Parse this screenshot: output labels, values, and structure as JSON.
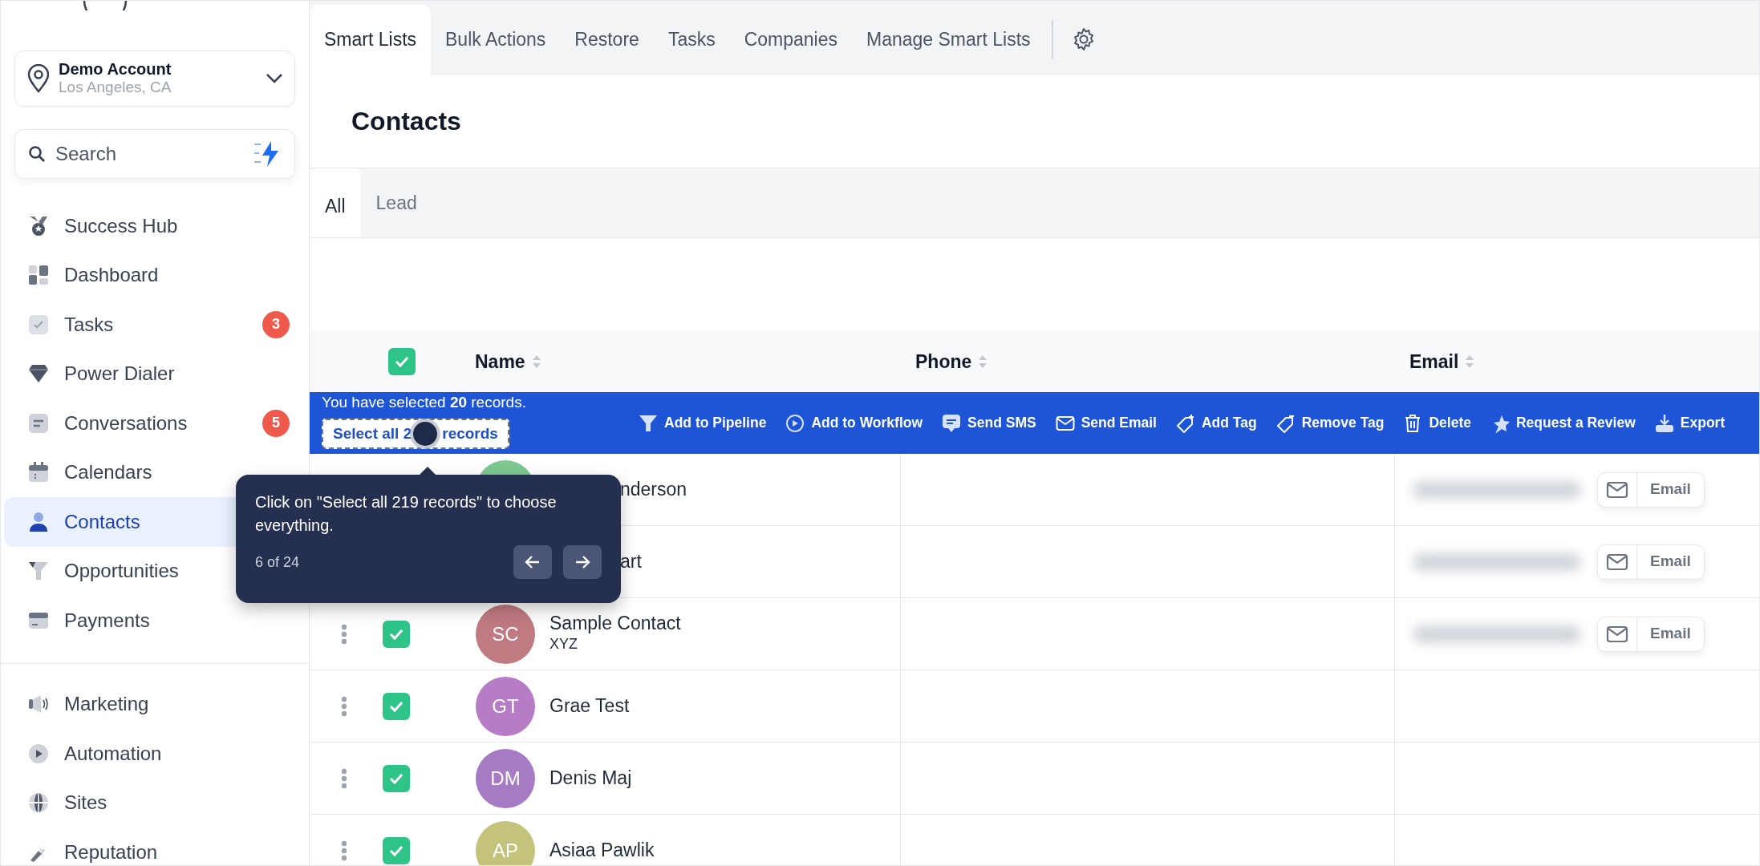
{
  "sidebar": {
    "account": {
      "name": "Demo Account",
      "location": "Los Angeles, CA"
    },
    "search": {
      "placeholder": "Search"
    },
    "sections": [
      {
        "items": [
          {
            "label": "Success Hub",
            "selected": false
          },
          {
            "label": "Dashboard",
            "selected": false
          },
          {
            "label": "Tasks",
            "selected": false,
            "badge": "3"
          },
          {
            "label": "Power Dialer",
            "selected": false
          },
          {
            "label": "Conversations",
            "selected": false,
            "badge": "5"
          },
          {
            "label": "Calendars",
            "selected": false
          },
          {
            "label": "Contacts",
            "selected": true
          },
          {
            "label": "Opportunities",
            "selected": false
          },
          {
            "label": "Payments",
            "selected": false
          }
        ]
      },
      {
        "items": [
          {
            "label": "Marketing",
            "selected": false
          },
          {
            "label": "Automation",
            "selected": false
          },
          {
            "label": "Sites",
            "selected": false
          },
          {
            "label": "Reputation",
            "selected": false
          }
        ]
      }
    ]
  },
  "top_tabs": [
    {
      "label": "Smart Lists",
      "selected": true
    },
    {
      "label": "Bulk Actions",
      "selected": false
    },
    {
      "label": "Restore",
      "selected": false
    },
    {
      "label": "Tasks",
      "selected": false
    },
    {
      "label": "Companies",
      "selected": false
    },
    {
      "label": "Manage Smart Lists",
      "selected": false
    }
  ],
  "page_title": "Contacts",
  "list_tabs": [
    {
      "label": "All",
      "selected": true
    },
    {
      "label": "Lead",
      "selected": false
    }
  ],
  "table": {
    "select_all_checked": true,
    "columns": [
      "Name",
      "Phone",
      "Email"
    ],
    "bulk_bar": {
      "message": "You have selected **20** records.",
      "select_all_start": "Select all 2",
      "select_all_end": "records",
      "actions": [
        {
          "label": "Add to Pipeline"
        },
        {
          "label": "Add to Workflow"
        },
        {
          "label": "Send SMS"
        },
        {
          "label": "Send Email"
        },
        {
          "label": "Add Tag"
        },
        {
          "label": "Remove Tag"
        },
        {
          "label": "Delete"
        },
        {
          "label": "Request a Review"
        },
        {
          "label": "Export"
        }
      ]
    },
    "rows": [
      {
        "covered": true,
        "color": "#7dc790",
        "name": "nderson",
        "email_blurred": true,
        "email_button": "Email"
      },
      {
        "covered": true,
        "name": "art",
        "email_blurred": true,
        "email_button": "Email"
      },
      {
        "covered": false,
        "checked": true,
        "initials": "SC",
        "color": "#c07a82",
        "name": "Sample Contact",
        "subtitle": "XYZ",
        "email_blurred": true,
        "email_button": "Email"
      },
      {
        "covered": false,
        "checked": true,
        "initials": "GT",
        "color": "#b67cc5",
        "name": "Grae Test",
        "email_blurred": false
      },
      {
        "covered": false,
        "checked": true,
        "initials": "DM",
        "color": "#a67bc3",
        "name": "Denis Maj",
        "email_blurred": false
      },
      {
        "covered": false,
        "checked": true,
        "initials": "AP",
        "color": "#c3c37b",
        "name": "Asiaa Pawlik",
        "email_blurred": false
      }
    ]
  },
  "tour_tooltip": {
    "text": "Click on \"Select all 219 records\" to choose everything.",
    "step": "6 of 24"
  }
}
